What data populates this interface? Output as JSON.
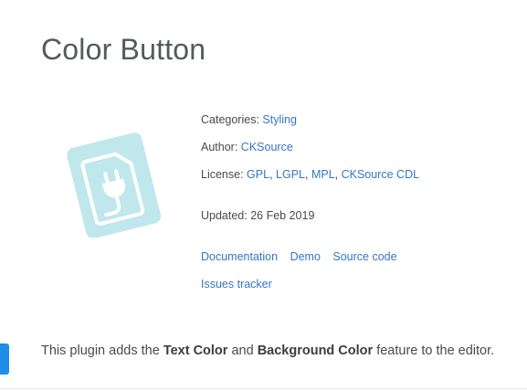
{
  "page": {
    "title": "Color Button"
  },
  "plugin_icon": {
    "name": "plugin-plug-icon",
    "color": "#bfe7ec"
  },
  "meta": {
    "categories_label": "Categories:",
    "categories_value": "Styling",
    "author_label": "Author:",
    "author_value": "CKSource",
    "license_label": "License:",
    "licenses": [
      "GPL",
      "LGPL",
      "MPL",
      "CKSource CDL"
    ],
    "updated_label": "Updated:",
    "updated_value": "26 Feb 2019"
  },
  "links": {
    "documentation": "Documentation",
    "demo": "Demo",
    "source_code": "Source code",
    "issues_tracker": "Issues tracker"
  },
  "description": {
    "prefix": "This plugin adds the ",
    "bold1": "Text Color",
    "middle": " and ",
    "bold2": "Background Color",
    "suffix": " feature to the editor."
  },
  "colors": {
    "link": "#3576c5",
    "accent_tab": "#1e8ee8"
  }
}
